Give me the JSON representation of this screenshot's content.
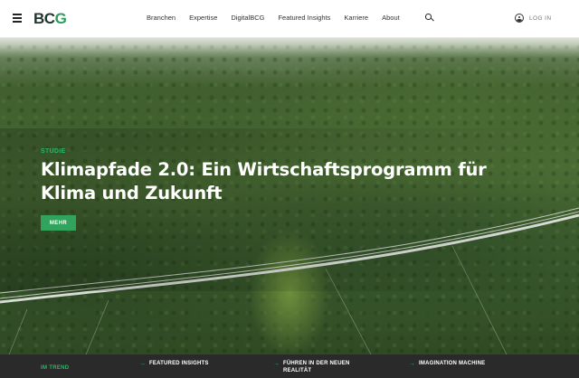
{
  "header": {
    "logo": "BCG",
    "nav": [
      "Branchen",
      "Expertise",
      "DigitalBCG",
      "Featured Insights",
      "Karriere",
      "About"
    ],
    "login_label": "LOG IN",
    "icons": [
      "menu-icon",
      "search-icon",
      "user-icon"
    ]
  },
  "hero": {
    "eyebrow": "STUDIE",
    "headline": "Klimapfade 2.0: Ein Wirtschaftsprogramm für Klima und Zukunft",
    "button_label": "MEHR"
  },
  "trend": {
    "label": "IM TREND",
    "links": [
      {
        "label": "FEATURED INSIGHTS"
      },
      {
        "label": "FÜHREN IN DER NEUEN REALITÄT"
      },
      {
        "label": "IMAGINATION MACHINE"
      }
    ],
    "arrow_icon": "arrow-right-icon"
  },
  "colors": {
    "accent": "#32a35c",
    "dark_bar": "#2a2a2a",
    "logo_green": "#2a9d5a"
  }
}
